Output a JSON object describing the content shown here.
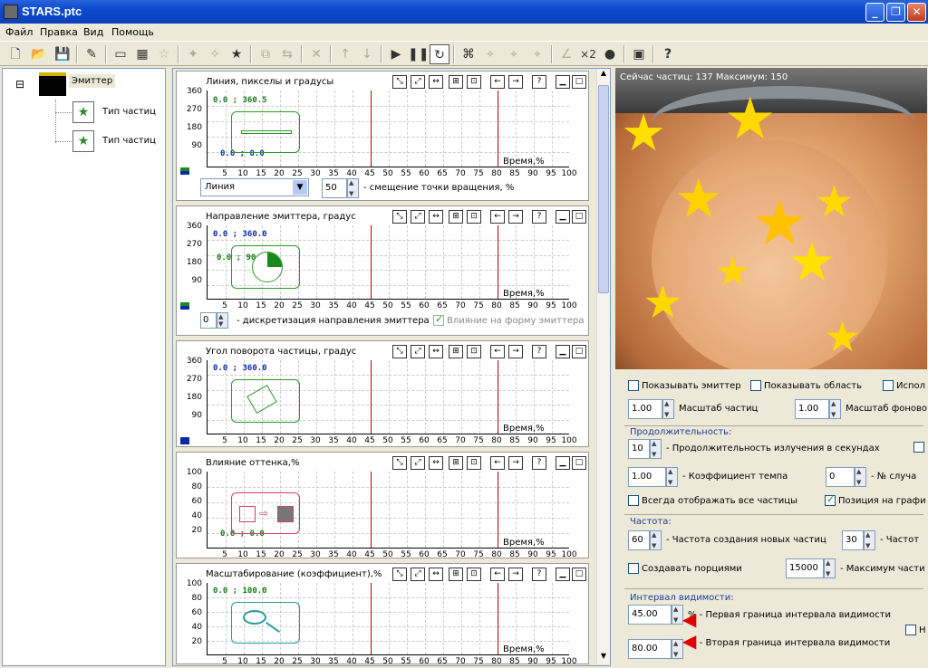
{
  "window": {
    "title": "STARS.ptc",
    "min": "_",
    "max": "❐",
    "close": "✕"
  },
  "menu": [
    "Файл",
    "Правка",
    "Вид",
    "Помощь"
  ],
  "tree": {
    "root": "Эмиттер",
    "children": [
      "Тип частиц",
      "Тип частиц"
    ],
    "collapse": "⊟"
  },
  "xticks": [
    "5",
    "10",
    "15",
    "20",
    "25",
    "30",
    "35",
    "40",
    "45",
    "50",
    "55",
    "60",
    "65",
    "70",
    "75",
    "80",
    "85",
    "90",
    "95",
    "100"
  ],
  "xlabel": "Время,%",
  "panel1": {
    "title": "Линия, пикселы и градусы",
    "yticks": [
      "360",
      "270",
      "180",
      "90"
    ],
    "value_top": "0.0 ; 360.5",
    "value_bottom": "0.0 ; 0.0",
    "select": "Линия",
    "spin": "50",
    "spin_label": "- смещение точки вращения, %"
  },
  "panel2": {
    "title": "Направление эмиттера, градус",
    "yticks": [
      "360",
      "270",
      "180",
      "90"
    ],
    "value_top": "0.0 ; 360.0",
    "value_mid": "0.0 ; 90.0",
    "spin": "0",
    "spin_label": "- дискретизация направления эмиттера",
    "check": "Влияние на форму эмиттера"
  },
  "panel3": {
    "title": "Угол поворота частицы, градус",
    "yticks": [
      "360",
      "270",
      "180",
      "90"
    ],
    "value_top": "0.0 ; 360.0"
  },
  "panel4": {
    "title": "Влияние оттенка,%",
    "yticks": [
      "100",
      "80",
      "60",
      "40",
      "20"
    ],
    "value_bottom": "0.0 ; 0.0"
  },
  "panel5": {
    "title": "Масштабирование (коэффициент),%",
    "yticks": [
      "100",
      "80",
      "60",
      "40",
      "20"
    ],
    "value_top": "0.0 ; 100.0"
  },
  "panel_buttons": [
    "⤡",
    "⤢",
    "↔",
    "⊞",
    "⊡",
    "←",
    "→",
    "?",
    "▁",
    "□"
  ],
  "photo_overlay": "Сейчас частиц: 137   Максимум: 150",
  "settings": {
    "show_emitter": "Показывать эмиттер",
    "show_area": "Показывать область",
    "use": "Испол",
    "scale_val": "1.00",
    "scale_label": "Масштаб частиц",
    "bg_scale_val": "1.00",
    "bg_scale_label": "Масштаб фоново",
    "duration_group": "Продолжительность:",
    "duration_val": "10",
    "duration_label": "- Продолжительность излучения в секундах",
    "tempo_val": "1.00",
    "tempo_label": "- Коэффициент темпа",
    "rand_val": "0",
    "rand_label": "- № случа",
    "always_show": "Всегда отображать все частицы",
    "pos_graph": "Позиция на графи",
    "freq_group": "Частота:",
    "freq_val": "60",
    "freq_label": "- Частота создания новых частиц",
    "freq2_val": "30",
    "freq2_label": "- Частот",
    "portions": "Создавать порциями",
    "max_val": "15000",
    "max_label": "- Максимум части",
    "vis_group": "Интервал видимости:",
    "first_val": "45.00",
    "first_label": "% - Первая граница интервала видимости",
    "second_val": "80.00",
    "second_label": "% - Вторая граница интервала видимости",
    "n_label": "Н"
  }
}
